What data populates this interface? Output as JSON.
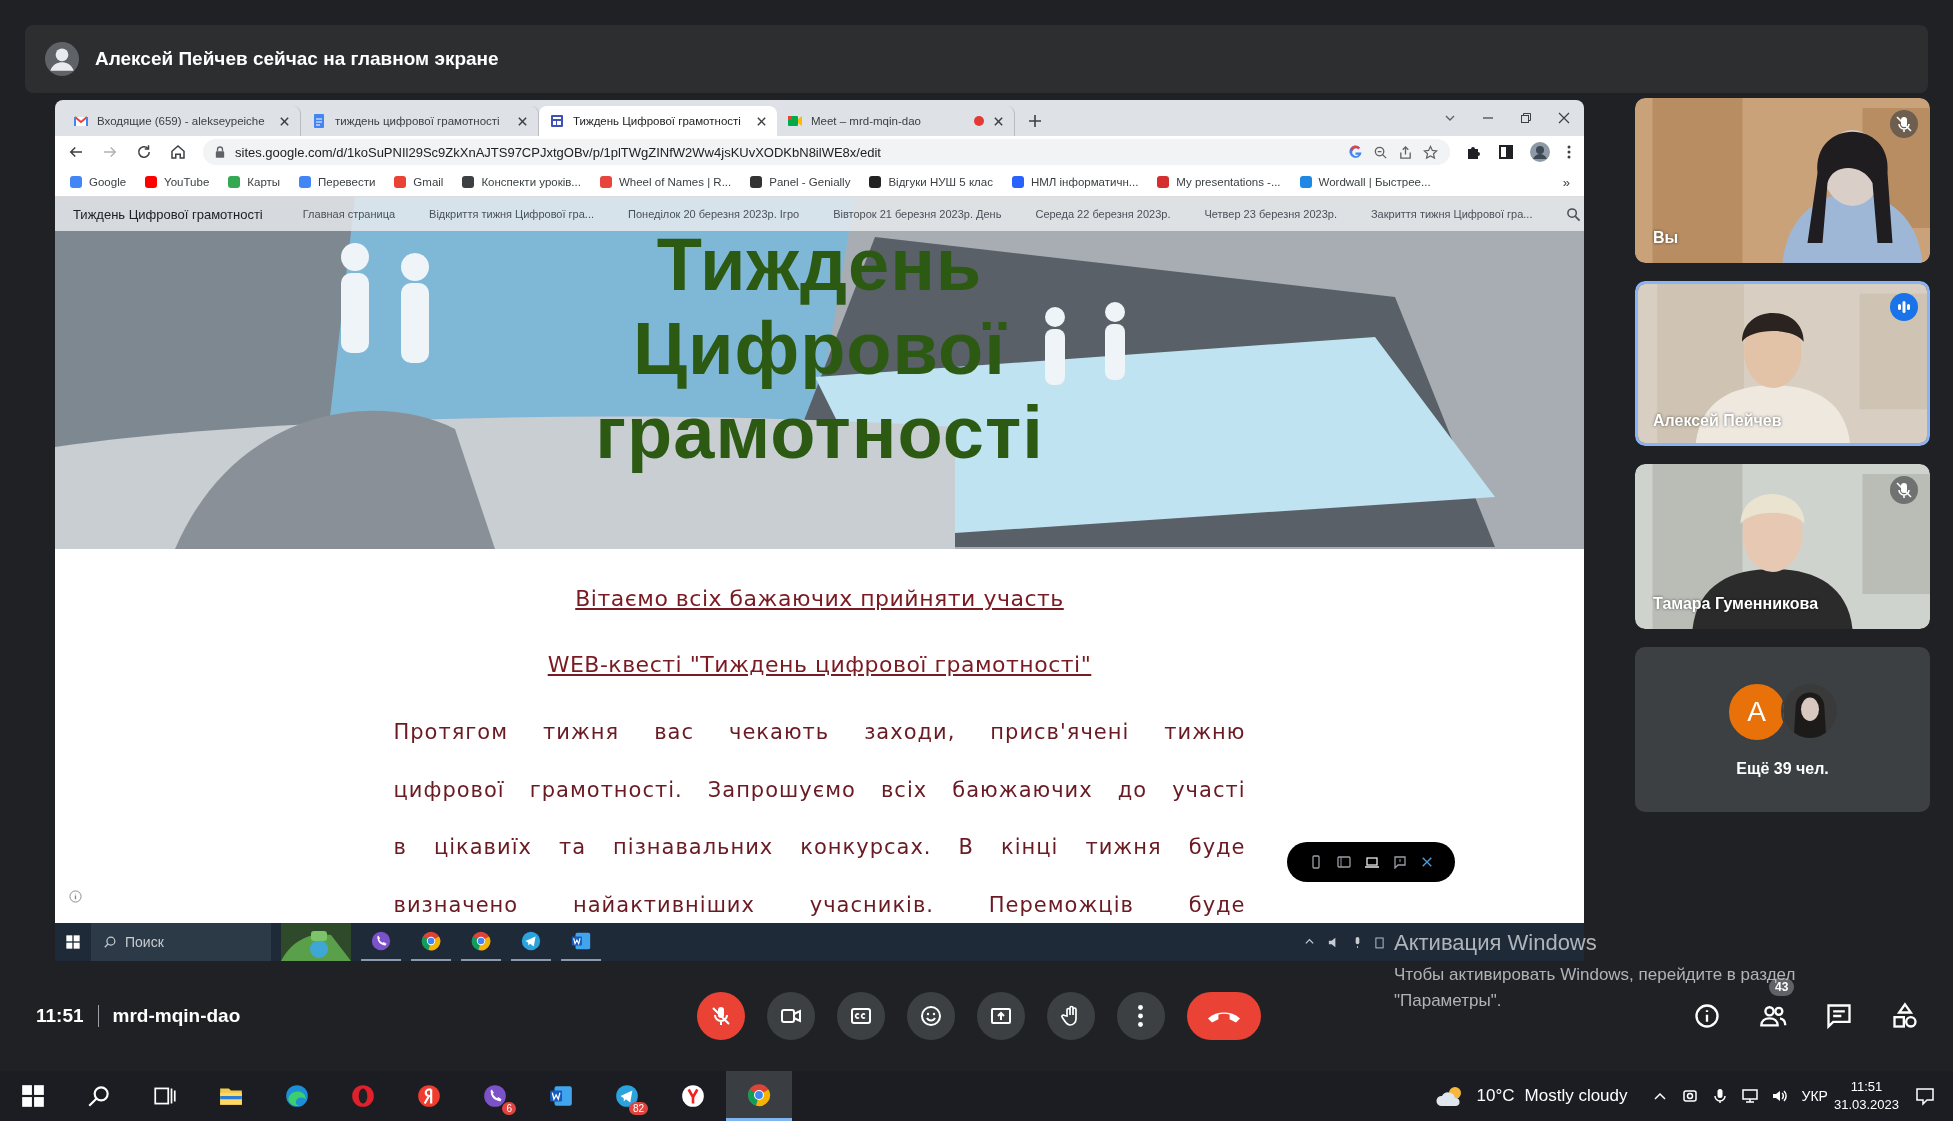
{
  "banner": {
    "text": "Алексей Пейчев сейчас на главном экране"
  },
  "browser": {
    "tabs": [
      {
        "kind": "mail",
        "title": "Входящие (659) - alekseypeiche",
        "selected": false,
        "recording": false
      },
      {
        "kind": "doc",
        "title": "тиждень цифрової грамотності",
        "selected": false,
        "recording": false
      },
      {
        "kind": "site",
        "title": "Тиждень Цифрової грамотності",
        "selected": true,
        "recording": false
      },
      {
        "kind": "meet",
        "title": "Meet – mrd-mqin-dao",
        "selected": false,
        "recording": true
      }
    ],
    "address": "sites.google.com/d/1koSuPNIl29Sc9ZkXnAJTS97CPJxtgOBv/p/1plTWgZINfW2Ww4jsKUvXODKbN8ilWE8x/edit",
    "bookmarks": [
      "Google",
      "YouTube",
      "Карты",
      "Перевести",
      "Gmail",
      "Конспекти уроків...",
      "Wheel of Names | R...",
      "Panel - Genially",
      "Відгуки НУШ 5 клас",
      "НМЛ інформатичн...",
      "My presentations -...",
      "Wordwall | Быстрее..."
    ],
    "bookmarks_more": "»",
    "site": {
      "name": "Тиждень Цифрової грамотності",
      "nav": [
        "Главная страница",
        "Відкриття тижня Цифрової гра...",
        "Понеділок 20 березня 2023р. Ігро",
        "Вівторок 21 березня 2023р. День",
        "Середа 22 березня 2023р.",
        "Четвер 23 березня 2023р.",
        "Закриття тижня Цифрової гра..."
      ],
      "hero_title": "Тиждень Цифрової грамотності",
      "links": [
        "Вітаємо всіх бажаючих прийняти участь",
        "WEB-квесті \"Тиждень цифрової грамотності\""
      ],
      "paragraph": "Протягом тижня вас чекають заходи, присв'ячені тижню\nцифрової грамотності. Запрошуємо всіх баюжаючих до участі\nв цікавиїх та пізнавальних конкурсах. В кінці тижня буде\nвизначено найактивніших учасників. Переможців буде"
    },
    "taskbar": {
      "search_placeholder": "Поиск",
      "apps": [
        {
          "kind": "viber"
        },
        {
          "kind": "chrome"
        },
        {
          "kind": "chrome"
        },
        {
          "kind": "telegram"
        },
        {
          "kind": "word"
        }
      ]
    }
  },
  "participants": [
    {
      "name": "Вы",
      "muted": true,
      "speaking": false
    },
    {
      "name": "Алексей Пейчев",
      "muted": false,
      "speaking": true
    },
    {
      "name": "Тамара Гуменникова",
      "muted": true,
      "speaking": false
    }
  ],
  "more_participants": {
    "avatar_letter": "A",
    "label": "Ещё 39 чел."
  },
  "meeting": {
    "time": "11:51",
    "code": "mrd-mqin-dao"
  },
  "controls": [
    {
      "kind": "mic",
      "muted": true
    },
    {
      "kind": "camera"
    },
    {
      "kind": "captions"
    },
    {
      "kind": "emoji"
    },
    {
      "kind": "present"
    },
    {
      "kind": "hand"
    },
    {
      "kind": "more"
    },
    {
      "kind": "end-call"
    }
  ],
  "side_controls": [
    {
      "kind": "info"
    },
    {
      "kind": "people",
      "badge": "43"
    },
    {
      "kind": "chat"
    },
    {
      "kind": "activities"
    }
  ],
  "activation": {
    "title": "Активация Windows",
    "lines": [
      "Чтобы активировать Windows, перейдите в раздел",
      "\"Параметры\"."
    ]
  },
  "windows_taskbar": {
    "apps": [
      {
        "kind": "start",
        "active": false
      },
      {
        "kind": "search",
        "active": false
      },
      {
        "kind": "taskview",
        "active": false
      },
      {
        "kind": "folder",
        "active": false
      },
      {
        "kind": "edge",
        "active": false
      },
      {
        "kind": "opera",
        "active": false
      },
      {
        "kind": "yandex",
        "active": false
      },
      {
        "kind": "viber",
        "active": false,
        "badge": "6"
      },
      {
        "kind": "word",
        "active": false
      },
      {
        "kind": "telegram",
        "active": false,
        "badge": "82"
      },
      {
        "kind": "ybrowser",
        "active": false
      },
      {
        "kind": "chrome",
        "active": true
      }
    ],
    "weather": "10°C",
    "weather_text": "Mostly cloudy",
    "language": "УКР",
    "time": "11:51",
    "date": "31.03.2023"
  }
}
